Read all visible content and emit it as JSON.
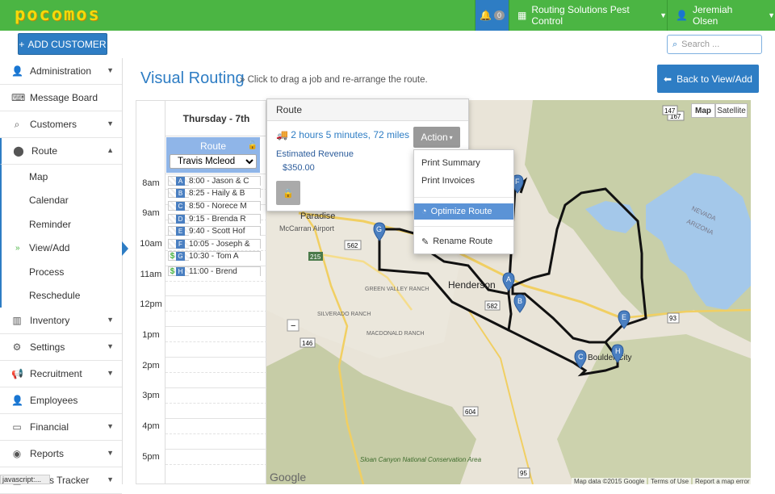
{
  "brand": {
    "logo_text": "pocomos",
    "logo_color": "#f5d90a",
    "topbar_color": "#4bb543"
  },
  "topnav": {
    "notifications_count": "0",
    "company": "Routing Solutions Pest Control",
    "user": "Jeremiah Olsen"
  },
  "toolbar": {
    "add_customer": "ADD CUSTOMER",
    "search_placeholder": "Search ..."
  },
  "sidebar": {
    "items": [
      {
        "label": "Administration",
        "icon": "person-icon"
      },
      {
        "label": "Message Board",
        "icon": "keyboard-icon"
      },
      {
        "label": "Customers",
        "icon": "search-icon"
      },
      {
        "label": "Route",
        "icon": "map-marker-icon"
      },
      {
        "label": "Inventory",
        "icon": "barcode-icon"
      },
      {
        "label": "Settings",
        "icon": "gear-icon"
      },
      {
        "label": "Recruitment",
        "icon": "bullhorn-icon"
      },
      {
        "label": "Employees",
        "icon": "person-icon"
      },
      {
        "label": "Financial",
        "icon": "credit-card-icon"
      },
      {
        "label": "Reports",
        "icon": "palette-icon"
      },
      {
        "label": "Sales Tracker",
        "icon": "chart-icon"
      }
    ],
    "route_sub": [
      "Map",
      "Calendar",
      "Reminder",
      "View/Add",
      "Process",
      "Reschedule"
    ],
    "active_sub": "View/Add"
  },
  "page": {
    "title": "Visual Routing",
    "subtitle": "» Click to drag a job and re-arrange the route.",
    "back_button": "Back to View/Add"
  },
  "calendar": {
    "day": "Thursday - 7th",
    "route_label": "Route",
    "tech": "Travis Mcleod",
    "times": [
      "8am",
      "9am",
      "10am",
      "11am",
      "12pm",
      "1pm",
      "2pm",
      "3pm",
      "4pm",
      "5pm"
    ],
    "jobs": [
      {
        "letter": "A",
        "text": "8:00 - Jason & C",
        "paid": false
      },
      {
        "letter": "B",
        "text": "8:25 - Haily & B",
        "paid": false
      },
      {
        "letter": "C",
        "text": "8:50 - Norece M",
        "paid": false
      },
      {
        "letter": "D",
        "text": "9:15 - Brenda R",
        "paid": false
      },
      {
        "letter": "E",
        "text": "9:40 - Scott Hof",
        "paid": false
      },
      {
        "letter": "F",
        "text": "10:05 - Joseph &",
        "paid": false
      },
      {
        "letter": "G",
        "text": "10:30 - Tom A",
        "paid": true
      },
      {
        "letter": "H",
        "text": "11:00 - Brend",
        "paid": true
      }
    ]
  },
  "route_popup": {
    "title": "Route",
    "duration": "2 hours 5 minutes, 72 miles",
    "revenue_label": "Estimated Revenue",
    "revenue_value": "$350.00",
    "action_label": "Action"
  },
  "action_menu": {
    "items": [
      "Print Summary",
      "Print Invoices",
      "Optimize Route",
      "Rename Route"
    ],
    "selected": "Optimize Route"
  },
  "map": {
    "type_buttons": [
      "Map",
      "Satellite"
    ],
    "places": [
      "Paradise",
      "McCarran Airport",
      "Henderson",
      "GREEN VALLEY RANCH",
      "SILVERADO RANCH",
      "MACDONALD RANCH",
      "Boulder City",
      "Sloan Canyon National Conservation Area",
      "NEVADA",
      "ARIZONA"
    ],
    "route_shields": [
      "167",
      "562",
      "215",
      "582",
      "93",
      "146",
      "604",
      "95",
      "147"
    ],
    "pins": [
      "A",
      "B",
      "C",
      "E",
      "F",
      "G",
      "H"
    ],
    "attribution": [
      "Map data ©2015 Google",
      "Terms of Use",
      "Report a map error"
    ],
    "google": "Google"
  },
  "statusbar": "javascript:..."
}
